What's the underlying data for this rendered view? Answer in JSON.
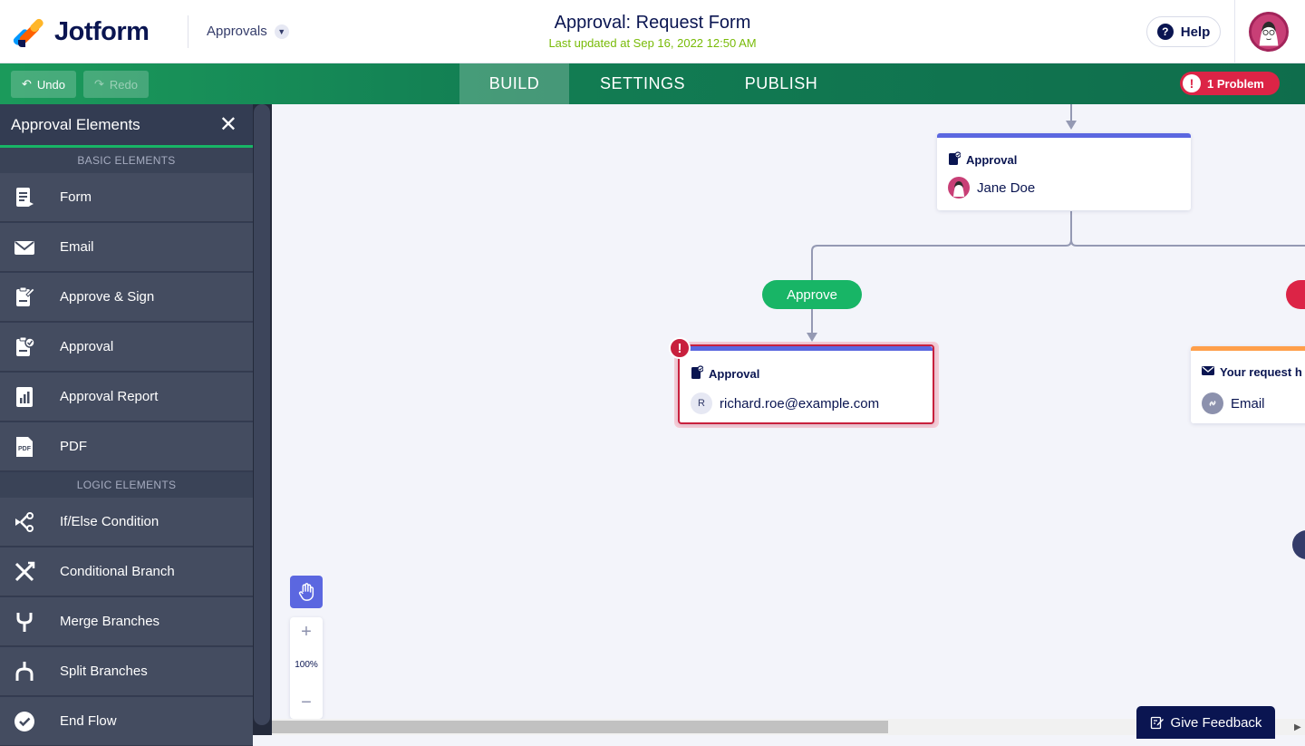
{
  "header": {
    "brand": "Jotform",
    "app_switcher": "Approvals",
    "title": "Approval: Request Form",
    "last_updated": "Last updated at Sep 16, 2022 12:50 AM",
    "help_label": "Help"
  },
  "toolbar": {
    "undo_label": "Undo",
    "redo_label": "Redo",
    "tabs": [
      {
        "label": "BUILD",
        "active": true
      },
      {
        "label": "SETTINGS",
        "active": false
      },
      {
        "label": "PUBLISH",
        "active": false
      }
    ],
    "problem_label": "1 Problem"
  },
  "sidebar": {
    "title": "Approval Elements",
    "basic_section": "BASIC ELEMENTS",
    "basic_items": [
      {
        "label": "Form",
        "icon": "form-icon"
      },
      {
        "label": "Email",
        "icon": "email-icon"
      },
      {
        "label": "Approve & Sign",
        "icon": "approve-sign-icon"
      },
      {
        "label": "Approval",
        "icon": "approval-icon"
      },
      {
        "label": "Approval Report",
        "icon": "report-icon"
      },
      {
        "label": "PDF",
        "icon": "pdf-icon"
      }
    ],
    "logic_section": "LOGIC ELEMENTS",
    "logic_items": [
      {
        "label": "If/Else Condition",
        "icon": "if-else-icon"
      },
      {
        "label": "Conditional Branch",
        "icon": "conditional-branch-icon"
      },
      {
        "label": "Merge Branches",
        "icon": "merge-icon"
      },
      {
        "label": "Split Branches",
        "icon": "split-icon"
      },
      {
        "label": "End Flow",
        "icon": "end-flow-icon"
      }
    ]
  },
  "canvas": {
    "node_top": {
      "type": "Approval",
      "assignee": "Jane Doe"
    },
    "approve_pill": "Approve",
    "node_approval": {
      "type": "Approval",
      "initial": "R",
      "assignee": "richard.roe@example.com"
    },
    "node_email": {
      "type": "Your request h",
      "recipient": "Email"
    },
    "colors": {
      "approval_accent": "#5b67e0",
      "email_accent": "#ff9f4a",
      "approve_green": "#18b566",
      "deny_red": "#dc2446",
      "error_red": "#c8203d"
    }
  },
  "zoom": {
    "level": "100%"
  },
  "feedback_label": "Give Feedback"
}
